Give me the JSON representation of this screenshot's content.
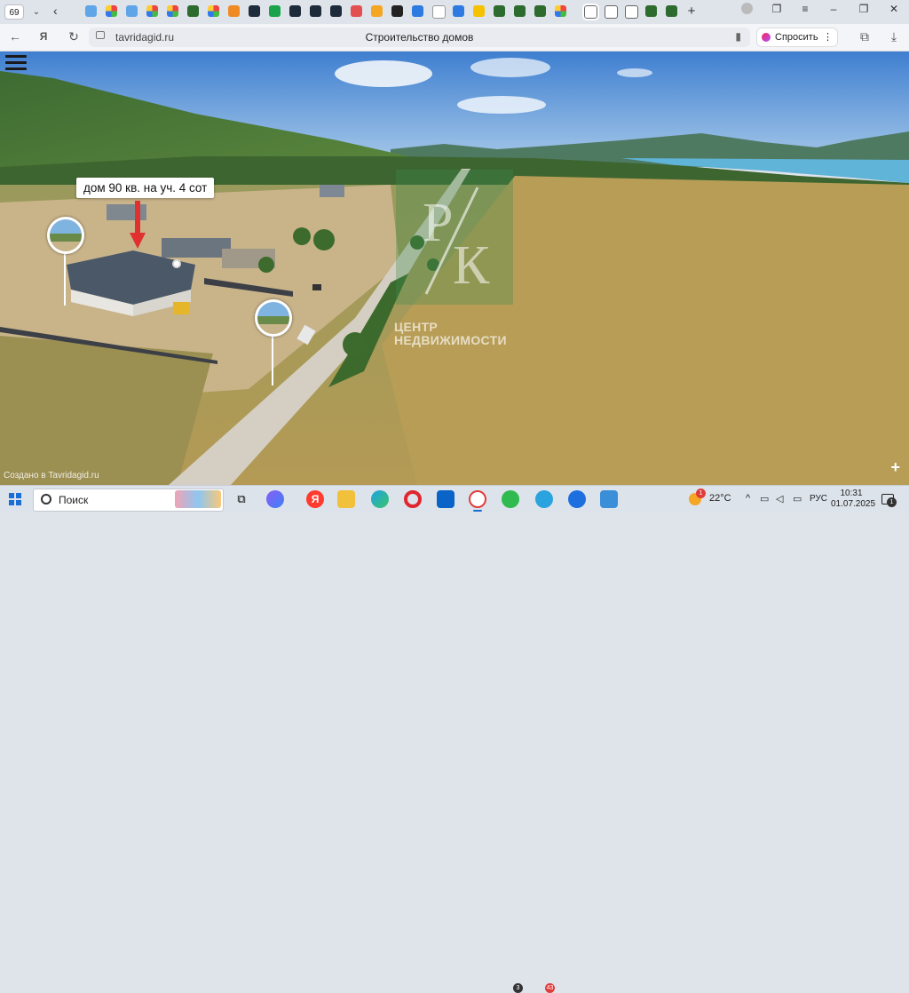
{
  "browser": {
    "tab_count": "69",
    "address": {
      "domain": "tavridagid.ru",
      "page_title": "Строительство домов"
    },
    "ask_button_label": "Спросить"
  },
  "panorama": {
    "callout_label": "дом 90 кв. на уч. 4 сот",
    "watermark_caption": "ЦЕНТР\nНЕДВИЖИМОСТИ",
    "credit_text": "Создано в Tavridagid.ru"
  },
  "taskbar": {
    "search_placeholder": "Поиск",
    "weather": "22°C",
    "language": "РУС",
    "time": "10:31",
    "date": "01.07.2025",
    "mail_badge": "3",
    "telegram_badge": "43",
    "notifications_badge": "1",
    "weather_badge": "1"
  },
  "colors": {
    "browser_bg": "#dfe3ea",
    "sky_top": "#3f7fd0",
    "field": "#b49a55",
    "accent_red": "#e03030"
  }
}
